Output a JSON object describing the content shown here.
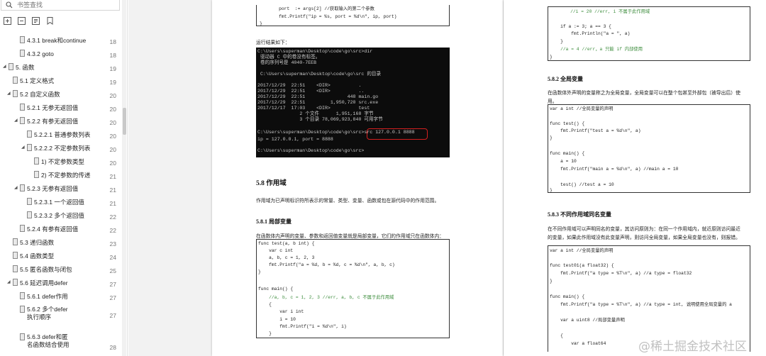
{
  "sidebar": {
    "search_placeholder": "书签查找",
    "items": [
      {
        "label": "4.3.1 break和continue",
        "page": "18"
      },
      {
        "label": "4.3.2 goto",
        "page": "18"
      },
      {
        "label": "5. 函数",
        "page": "19"
      },
      {
        "label": "5.1 定义格式",
        "page": "19"
      },
      {
        "label": "5.2 自定义函数",
        "page": "20"
      },
      {
        "label": "5.2.1 无参无返回值",
        "page": "20"
      },
      {
        "label": "5.2.2 有参无返回值",
        "page": "20"
      },
      {
        "label": "5.2.2.1 普通参数列表",
        "page": "20"
      },
      {
        "label": "5.2.2.2 不定参数列表",
        "page": "20"
      },
      {
        "label": "1) 不定参数类型",
        "page": "20"
      },
      {
        "label": "2) 不定参数的传递",
        "page": "21"
      },
      {
        "label": "5.2.3 无参有返回值",
        "page": "21"
      },
      {
        "label": "5.2.3.1 一个返回值",
        "page": "21"
      },
      {
        "label": "5.2.3.2 多个返回值",
        "page": "22"
      },
      {
        "label": "5.2.4 有参有返回值",
        "page": "22"
      },
      {
        "label": "5.3 递归函数",
        "page": "23"
      },
      {
        "label": "5.4 函数类型",
        "page": "24"
      },
      {
        "label": "5.5 匿名函数与闭包",
        "page": "25"
      },
      {
        "label": "5.6 延迟调用defer",
        "page": "27"
      },
      {
        "label": "5.6.1 defer作用",
        "page": "27"
      },
      {
        "label": "5.6.2 多个defer执行顺序",
        "page": "27"
      },
      {
        "label": "5.6.3 defer和匿名函数结合使用",
        "page": "28"
      }
    ]
  },
  "left_page": {
    "top_code": [
      "    port  := args[2] //获取输入的第二个参数",
      "    fmt.Printf(\"ip = %s, port = %d\\n\", ip, port)",
      "}"
    ],
    "run_result_label": "运行结果如下：",
    "terminal": [
      "C:\\Users\\superman\\Desktop\\code\\go\\src>dir",
      " 驱动器 C 中的卷没有标签。",
      " 卷的序列号是 4040-7EEB",
      "",
      " C:\\Users\\superman\\Desktop\\code\\go\\src 的目录",
      "",
      "2017/12/29  22:51    <DIR>          .",
      "2017/12/29  22:51    <DIR>          ..",
      "2017/12/29  22:51               448 main.go",
      "2017/12/29  22:51         1,950,720 src.exe",
      "2017/12/17  17:03    <DIR>          test",
      "               2 个文件      1,951,168 字节",
      "               3 个目录 78,069,923,840 可用字节",
      "",
      "C:\\Users\\superman\\Desktop\\code\\go\\src>src 127.0.0.1 8888",
      "ip = 127.0.0.1, port = 8888",
      "",
      "C:\\Users\\superman\\Desktop\\code\\go\\src>"
    ],
    "section_heading": "5.8  作用域",
    "section_text": "作用域为已声明标识符所表示的常量、类型、变量、函数或包在源代码中的作用范围。",
    "sub_heading": "5.8.1  局部变量",
    "sub_text": "在函数体内声明的变量、参数和返回值变量就是局部变量，它们的作用域只在函数体内：",
    "local_code": [
      "func test(a, b int) {",
      "    var c int",
      "    a, b, c = 1, 2, 3",
      "    fmt.Printf(\"a = %d, b = %d, c = %d\\n\", a, b, c)",
      "}",
      "",
      "func main() {",
      "    //a, b, c = 1, 2, 3 //err, a, b, c 不属于此作用域",
      "    {",
      "        var i int",
      "        i = 10",
      "        fmt.Printf(\"i = %d\\n\", i)",
      "    }"
    ]
  },
  "right_page": {
    "top_code": [
      "    //i = 20 //err, i 不属于此作用域",
      "",
      "    if a := 3; a == 3 {",
      "        fmt.Println(\"a = \", a)",
      "    }",
      "    //a = 4 //err，a 只能 if 内部使用",
      "}"
    ],
    "global_heading": "5.8.2  全局变量",
    "global_text_1": "在函数体外声明的变量称之为全局变量，全局变量可以在整个包甚至外部包（被导出后）使",
    "global_text_2": "用。",
    "global_code": [
      "var a int //全局变量的声明",
      "",
      "func test() {",
      "    fmt.Printf(\"test a = %d\\n\", a)",
      "}",
      "",
      "func main() {",
      "    a = 10",
      "    fmt.Printf(\"main a = %d\\n\", a) //main a = 10",
      "",
      "    test() //test a = 10",
      "}"
    ],
    "same_name_heading": "5.8.3  不同作用域同名变量",
    "same_name_text_1": "在不同作用域可以声明同名的变量，其访问原则为：在同一个作用域内，就近原则访问最近",
    "same_name_text_2": "的变量，如果此作用域没有此变量声明，则访问全局变量，如果全局变量也没有，则报错。",
    "same_name_code": [
      "var a int //全局变量的声明",
      "",
      "func test01(a float32) {",
      "    fmt.Printf(\"a type = %T\\n\", a) //a type = float32",
      "}",
      "",
      "func main() {",
      "    fmt.Printf(\"a type = %T\\n\", a) //a type = int, 说明使用全局变量的 a",
      "",
      "    var a uint8 //局部变量声明",
      "",
      "    {",
      "        var a float64"
    ]
  },
  "watermark": "@稀土掘金技术社区"
}
